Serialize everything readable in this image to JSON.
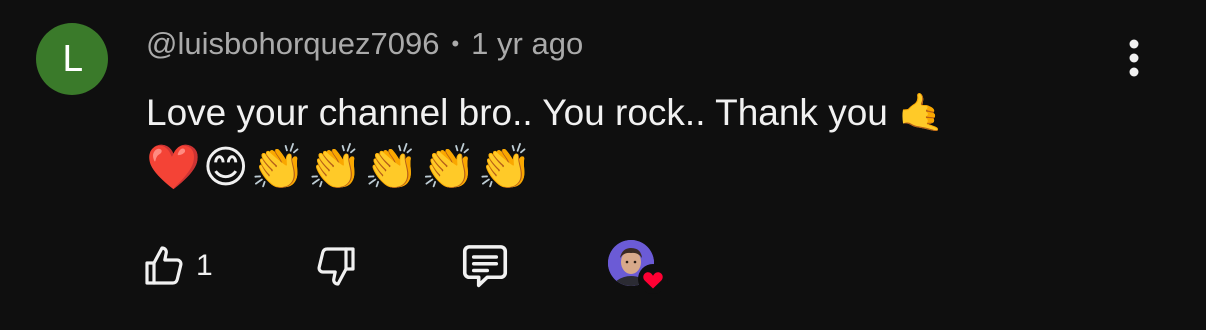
{
  "comment": {
    "author_initial": "L",
    "author_handle": "@luisbohorquez7096",
    "separator": "•",
    "timestamp": "1 yr ago",
    "text": "Love your channel bro.. You rock.. Thank you",
    "text_emoji": "🤙",
    "emoji_line": "❤️😊👏👏👏👏👏",
    "avatar_color": "#3a7a2a"
  },
  "actions": {
    "like_count": "1"
  },
  "icons": {
    "more": "more-vert-icon",
    "like": "thumbs-up-icon",
    "dislike": "thumbs-down-icon",
    "reply": "comment-icon",
    "creator_heart": "heart-icon"
  },
  "colors": {
    "background": "#0f0f0f",
    "text": "#f1f1f1",
    "meta": "#aaaaaa",
    "heart": "#ff0033"
  }
}
